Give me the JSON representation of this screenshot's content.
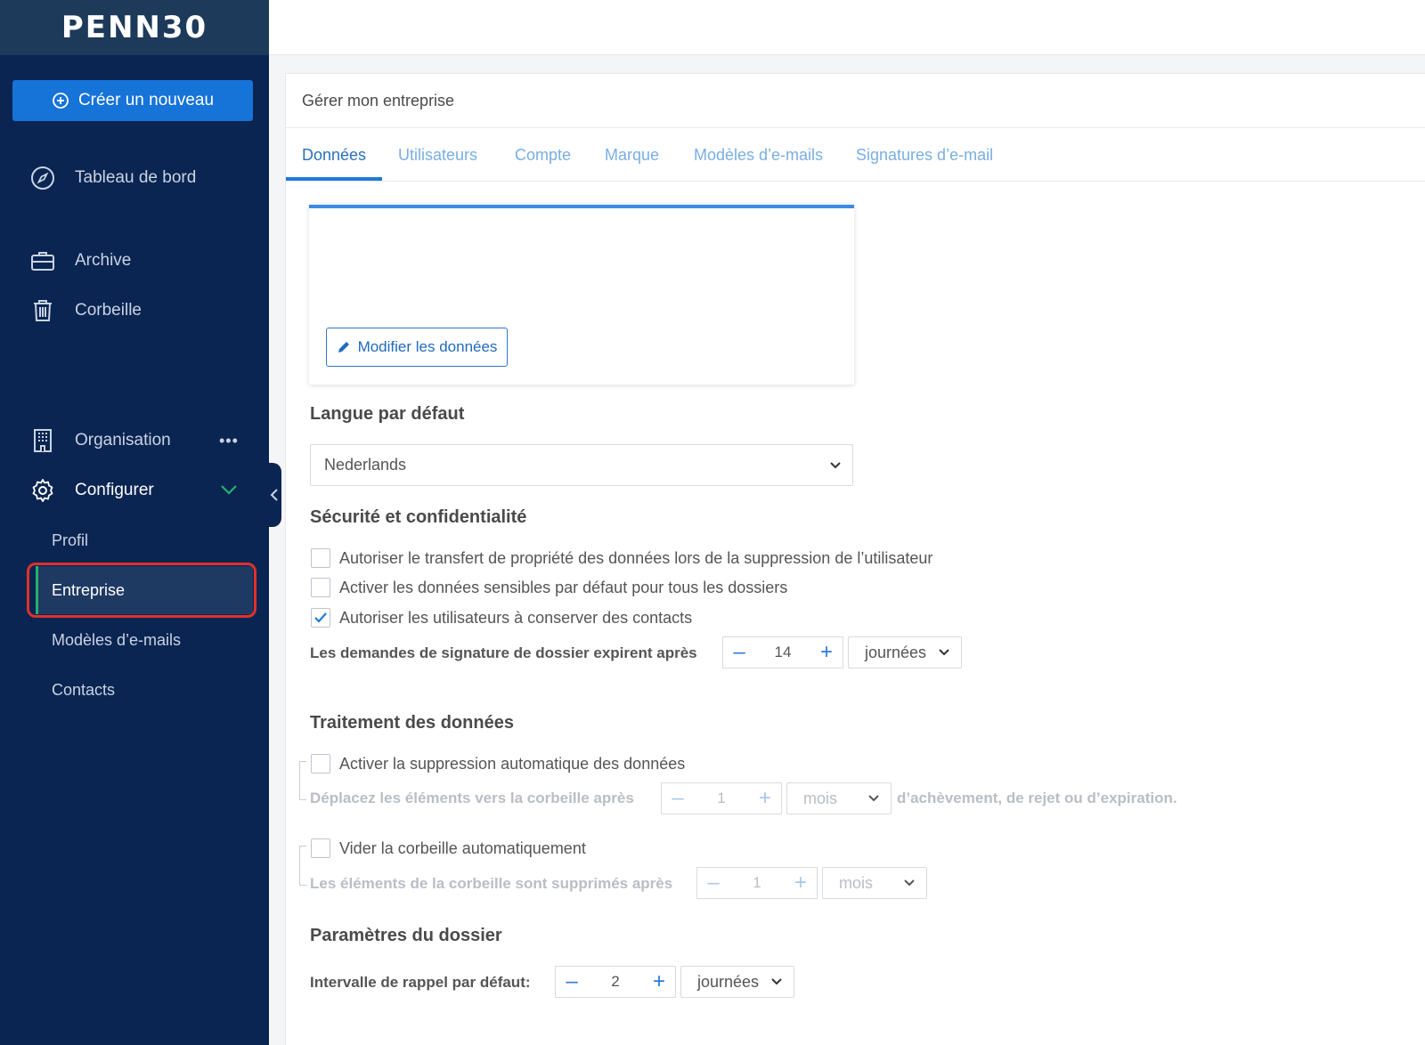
{
  "brand": {
    "logo_text": "PENN30"
  },
  "sidebar": {
    "create_label": "Créer un nouveau",
    "items": [
      {
        "label": "Tableau de bord",
        "icon": "compass-icon"
      },
      {
        "label": "Archive",
        "icon": "briefcase-icon"
      },
      {
        "label": "Corbeille",
        "icon": "trash-icon"
      },
      {
        "label": "Organisation",
        "icon": "building-icon"
      },
      {
        "label": "Configurer",
        "icon": "gear-icon"
      }
    ],
    "more_dots": "•••",
    "sub_items": [
      {
        "label": "Profil"
      },
      {
        "label": "Entreprise"
      },
      {
        "label": "Modèles d’e-mails"
      },
      {
        "label": "Contacts"
      }
    ]
  },
  "panel": {
    "title": "Gérer mon entreprise",
    "tabs": [
      {
        "label": "Données"
      },
      {
        "label": "Utilisateurs"
      },
      {
        "label": "Compte"
      },
      {
        "label": "Marque"
      },
      {
        "label": "Modèles d’e-mails"
      },
      {
        "label": "Signatures d’e-mail"
      }
    ],
    "edit_button": "Modifier les données"
  },
  "language": {
    "title": "Langue par défaut",
    "selected": "Nederlands"
  },
  "security": {
    "title": "Sécurité et confidentialité",
    "options": [
      {
        "label": "Autoriser le transfert de propriété des données lors de la suppression de l’utilisateur",
        "checked": false
      },
      {
        "label": "Activer les données sensibles par défaut pour tous les dossiers",
        "checked": false
      },
      {
        "label": "Autoriser les utilisateurs à conserver des contacts",
        "checked": true
      }
    ],
    "expiry_label": "Les demandes de signature de dossier expirent après",
    "expiry_value": "14",
    "expiry_unit": "journées"
  },
  "processing": {
    "title": "Traitement des données",
    "auto_delete_label": "Activer la suppression automatique des données",
    "move_label": "Déplacez les éléments vers la corbeille après",
    "move_value": "1",
    "move_unit": "mois",
    "move_after": "d’achèvement, de rejet ou d’expiration.",
    "empty_trash_label": "Vider la corbeille automatiquement",
    "trash_label": "Les éléments de la corbeille sont supprimés après",
    "trash_value": "1",
    "trash_unit": "mois"
  },
  "folder": {
    "title": "Paramètres du dossier",
    "reminder_label": "Intervalle de rappel par défaut:",
    "reminder_value": "2",
    "reminder_unit": "journées"
  },
  "colors": {
    "sidebar_bg": "#0b2552",
    "accent": "#1673d8",
    "active_indicator": "#23b26d",
    "highlight": "#e0312b"
  }
}
